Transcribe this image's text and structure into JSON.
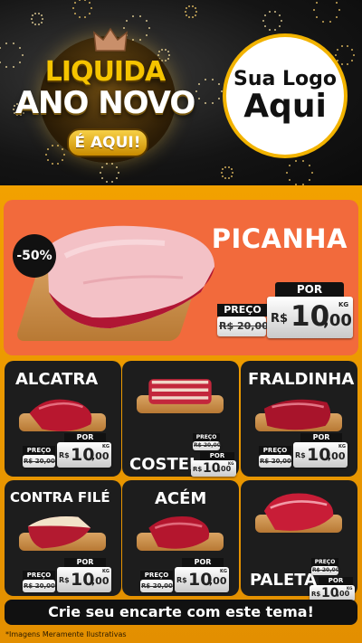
{
  "header": {
    "logo_line1": "LIQUIDA",
    "logo_line2": "ANO NOVO",
    "logo_pill": "É AQUI!",
    "placeholder_logo_top": "Sua Logo",
    "placeholder_logo_bottom": "Aqui"
  },
  "colors": {
    "background_orange": "#f2a100",
    "hero_coral": "#f26a3c",
    "card_dark": "#1d1d1d",
    "gold": "#f5c400"
  },
  "featured": {
    "discount": "-50%",
    "name": "PICANHA",
    "preco_label": "PREÇO",
    "por_label": "POR",
    "old_price": "R$ 20,00",
    "currency": "R$",
    "new_price_int": "10",
    "new_price_cents": ",00",
    "unit": "KG"
  },
  "products": [
    {
      "name": "ALCATRA",
      "preco_label": "PREÇO",
      "por_label": "POR",
      "old_price": "R$ 20,00",
      "currency": "R$",
      "new_price_int": "10",
      "new_price_cents": ",00",
      "unit": "KG"
    },
    {
      "name": "COSTELA",
      "preco_label": "PREÇO",
      "por_label": "POR",
      "old_price": "R$ 20,00",
      "currency": "R$",
      "new_price_int": "10",
      "new_price_cents": ",00",
      "unit": "KG"
    },
    {
      "name": "FRALDINHA",
      "preco_label": "PREÇO",
      "por_label": "POR",
      "old_price": "R$ 20,00",
      "currency": "R$",
      "new_price_int": "10",
      "new_price_cents": ",00",
      "unit": "KG"
    },
    {
      "name": "CONTRA FILÉ",
      "preco_label": "PREÇO",
      "por_label": "POR",
      "old_price": "R$ 20,00",
      "currency": "R$",
      "new_price_int": "10",
      "new_price_cents": ",00",
      "unit": "KG"
    },
    {
      "name": "ACÉM",
      "preco_label": "PREÇO",
      "por_label": "POR",
      "old_price": "R$ 20,00",
      "currency": "R$",
      "new_price_int": "10",
      "new_price_cents": ",00",
      "unit": "KG"
    },
    {
      "name": "PALETA",
      "preco_label": "PREÇO",
      "por_label": "POR",
      "old_price": "R$ 20,00",
      "currency": "R$",
      "new_price_int": "10",
      "new_price_cents": ",00",
      "unit": "KG"
    }
  ],
  "cta": "Crie seu encarte com este tema!",
  "footnote": "*Imagens Meramente Ilustrativas"
}
